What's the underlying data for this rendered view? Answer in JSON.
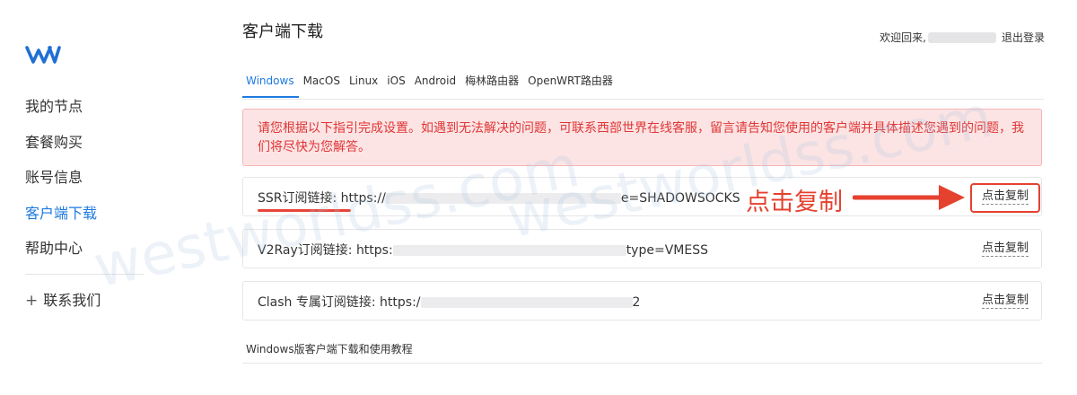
{
  "sidebar": {
    "logo_icon": "w-logo-icon",
    "items": [
      {
        "label": "我的节点"
      },
      {
        "label": "套餐购买"
      },
      {
        "label": "账号信息"
      },
      {
        "label": "客户端下载",
        "active": true
      },
      {
        "label": "帮助中心"
      }
    ],
    "contact_label": "联系我们",
    "contact_icon": "plus-icon"
  },
  "header": {
    "title": "客户端下载",
    "welcome": "欢迎回来,",
    "logout": "退出登录"
  },
  "tabs": [
    {
      "label": "Windows",
      "active": true
    },
    {
      "label": "MacOS"
    },
    {
      "label": "Linux"
    },
    {
      "label": "iOS"
    },
    {
      "label": "Android"
    },
    {
      "label": "梅林路由器"
    },
    {
      "label": "OpenWRT路由器"
    }
  ],
  "alert": {
    "text": "请您根据以下指引完成设置。如遇到无法解决的问题，可联系西部世界在线客服，留言请告知您使用的客户端并具体描述您遇到的问题，我们将尽快为您解答。"
  },
  "links": [
    {
      "label": "SSR订阅链接: ",
      "url_start": "https://",
      "url_end": "e=SHADOWSOCKS",
      "copy": "点击复制"
    },
    {
      "label": "V2Ray订阅链接: ",
      "url_start": "https:",
      "url_end": "type=VMESS",
      "copy": "点击复制"
    },
    {
      "label": "Clash 专属订阅链接: ",
      "url_start": "https:/",
      "url_end": "2",
      "copy": "点击复制"
    }
  ],
  "tutorial": "Windows版客户端下载和使用教程",
  "annotation": {
    "text": "点击复制",
    "color": "#e5412f"
  },
  "watermark": "westworldss.com",
  "colors": {
    "accent": "#1f7ae0",
    "alert_text": "#e03636",
    "alert_bg": "#fce4e4"
  }
}
